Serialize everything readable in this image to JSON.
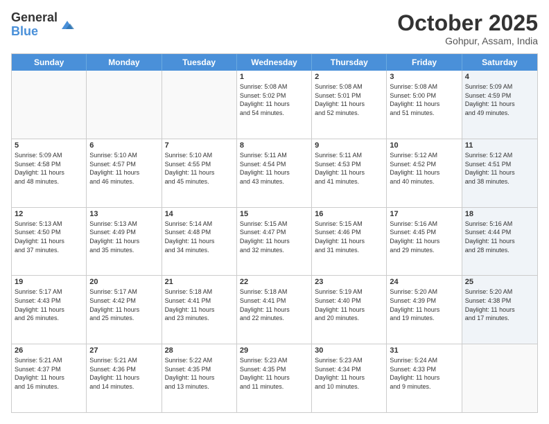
{
  "logo": {
    "general": "General",
    "blue": "Blue"
  },
  "title": "October 2025",
  "subtitle": "Gohpur, Assam, India",
  "header_days": [
    "Sunday",
    "Monday",
    "Tuesday",
    "Wednesday",
    "Thursday",
    "Friday",
    "Saturday"
  ],
  "weeks": [
    [
      {
        "day": "",
        "text": "",
        "shaded": true,
        "empty": true
      },
      {
        "day": "",
        "text": "",
        "shaded": true,
        "empty": true
      },
      {
        "day": "",
        "text": "",
        "shaded": true,
        "empty": true
      },
      {
        "day": "1",
        "text": "Sunrise: 5:08 AM\nSunset: 5:02 PM\nDaylight: 11 hours\nand 54 minutes.",
        "shaded": false
      },
      {
        "day": "2",
        "text": "Sunrise: 5:08 AM\nSunset: 5:01 PM\nDaylight: 11 hours\nand 52 minutes.",
        "shaded": false
      },
      {
        "day": "3",
        "text": "Sunrise: 5:08 AM\nSunset: 5:00 PM\nDaylight: 11 hours\nand 51 minutes.",
        "shaded": false
      },
      {
        "day": "4",
        "text": "Sunrise: 5:09 AM\nSunset: 4:59 PM\nDaylight: 11 hours\nand 49 minutes.",
        "shaded": true
      }
    ],
    [
      {
        "day": "5",
        "text": "Sunrise: 5:09 AM\nSunset: 4:58 PM\nDaylight: 11 hours\nand 48 minutes.",
        "shaded": false
      },
      {
        "day": "6",
        "text": "Sunrise: 5:10 AM\nSunset: 4:57 PM\nDaylight: 11 hours\nand 46 minutes.",
        "shaded": false
      },
      {
        "day": "7",
        "text": "Sunrise: 5:10 AM\nSunset: 4:55 PM\nDaylight: 11 hours\nand 45 minutes.",
        "shaded": false
      },
      {
        "day": "8",
        "text": "Sunrise: 5:11 AM\nSunset: 4:54 PM\nDaylight: 11 hours\nand 43 minutes.",
        "shaded": false
      },
      {
        "day": "9",
        "text": "Sunrise: 5:11 AM\nSunset: 4:53 PM\nDaylight: 11 hours\nand 41 minutes.",
        "shaded": false
      },
      {
        "day": "10",
        "text": "Sunrise: 5:12 AM\nSunset: 4:52 PM\nDaylight: 11 hours\nand 40 minutes.",
        "shaded": false
      },
      {
        "day": "11",
        "text": "Sunrise: 5:12 AM\nSunset: 4:51 PM\nDaylight: 11 hours\nand 38 minutes.",
        "shaded": true
      }
    ],
    [
      {
        "day": "12",
        "text": "Sunrise: 5:13 AM\nSunset: 4:50 PM\nDaylight: 11 hours\nand 37 minutes.",
        "shaded": false
      },
      {
        "day": "13",
        "text": "Sunrise: 5:13 AM\nSunset: 4:49 PM\nDaylight: 11 hours\nand 35 minutes.",
        "shaded": false
      },
      {
        "day": "14",
        "text": "Sunrise: 5:14 AM\nSunset: 4:48 PM\nDaylight: 11 hours\nand 34 minutes.",
        "shaded": false
      },
      {
        "day": "15",
        "text": "Sunrise: 5:15 AM\nSunset: 4:47 PM\nDaylight: 11 hours\nand 32 minutes.",
        "shaded": false
      },
      {
        "day": "16",
        "text": "Sunrise: 5:15 AM\nSunset: 4:46 PM\nDaylight: 11 hours\nand 31 minutes.",
        "shaded": false
      },
      {
        "day": "17",
        "text": "Sunrise: 5:16 AM\nSunset: 4:45 PM\nDaylight: 11 hours\nand 29 minutes.",
        "shaded": false
      },
      {
        "day": "18",
        "text": "Sunrise: 5:16 AM\nSunset: 4:44 PM\nDaylight: 11 hours\nand 28 minutes.",
        "shaded": true
      }
    ],
    [
      {
        "day": "19",
        "text": "Sunrise: 5:17 AM\nSunset: 4:43 PM\nDaylight: 11 hours\nand 26 minutes.",
        "shaded": false
      },
      {
        "day": "20",
        "text": "Sunrise: 5:17 AM\nSunset: 4:42 PM\nDaylight: 11 hours\nand 25 minutes.",
        "shaded": false
      },
      {
        "day": "21",
        "text": "Sunrise: 5:18 AM\nSunset: 4:41 PM\nDaylight: 11 hours\nand 23 minutes.",
        "shaded": false
      },
      {
        "day": "22",
        "text": "Sunrise: 5:18 AM\nSunset: 4:41 PM\nDaylight: 11 hours\nand 22 minutes.",
        "shaded": false
      },
      {
        "day": "23",
        "text": "Sunrise: 5:19 AM\nSunset: 4:40 PM\nDaylight: 11 hours\nand 20 minutes.",
        "shaded": false
      },
      {
        "day": "24",
        "text": "Sunrise: 5:20 AM\nSunset: 4:39 PM\nDaylight: 11 hours\nand 19 minutes.",
        "shaded": false
      },
      {
        "day": "25",
        "text": "Sunrise: 5:20 AM\nSunset: 4:38 PM\nDaylight: 11 hours\nand 17 minutes.",
        "shaded": true
      }
    ],
    [
      {
        "day": "26",
        "text": "Sunrise: 5:21 AM\nSunset: 4:37 PM\nDaylight: 11 hours\nand 16 minutes.",
        "shaded": false
      },
      {
        "day": "27",
        "text": "Sunrise: 5:21 AM\nSunset: 4:36 PM\nDaylight: 11 hours\nand 14 minutes.",
        "shaded": false
      },
      {
        "day": "28",
        "text": "Sunrise: 5:22 AM\nSunset: 4:35 PM\nDaylight: 11 hours\nand 13 minutes.",
        "shaded": false
      },
      {
        "day": "29",
        "text": "Sunrise: 5:23 AM\nSunset: 4:35 PM\nDaylight: 11 hours\nand 11 minutes.",
        "shaded": false
      },
      {
        "day": "30",
        "text": "Sunrise: 5:23 AM\nSunset: 4:34 PM\nDaylight: 11 hours\nand 10 minutes.",
        "shaded": false
      },
      {
        "day": "31",
        "text": "Sunrise: 5:24 AM\nSunset: 4:33 PM\nDaylight: 11 hours\nand 9 minutes.",
        "shaded": false
      },
      {
        "day": "",
        "text": "",
        "shaded": true,
        "empty": true
      }
    ]
  ]
}
